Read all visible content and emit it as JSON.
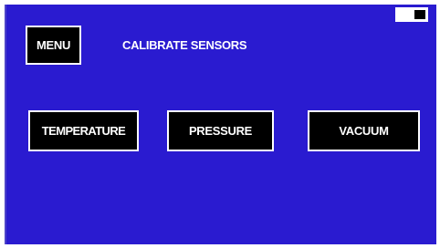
{
  "header": {
    "menu_label": "MENU",
    "title": "CALIBRATE SENSORS"
  },
  "sensors": {
    "temperature_label": "TEMPERATURE",
    "pressure_label": "PRESSURE",
    "vacuum_label": "VACUUM"
  },
  "status": {
    "battery_icon": "battery-icon"
  },
  "colors": {
    "background": "#2a1bd0",
    "button_bg": "#000000",
    "button_border": "#ffffff",
    "text": "#ffffff"
  }
}
